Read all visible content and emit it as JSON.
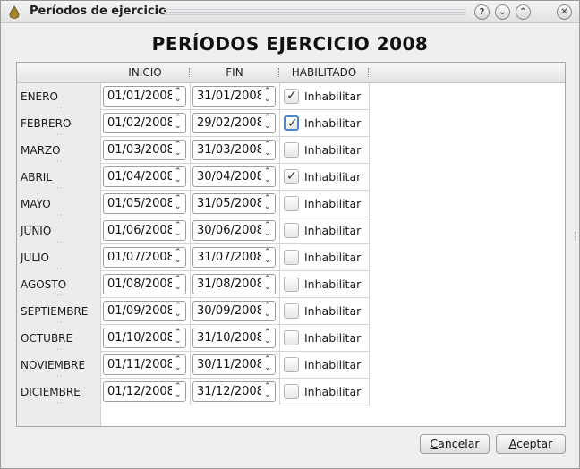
{
  "window": {
    "title": "Períodos de ejercicio",
    "buttons": {
      "help": "?",
      "minimize": "⌄",
      "maximize": "⌃",
      "close": "✕"
    }
  },
  "heading": "PERÍODOS EJERCICIO 2008",
  "table": {
    "columns": [
      "INICIO",
      "FIN",
      "HABILITADO"
    ],
    "checkbox_label": "Inhabilitar",
    "rows": [
      {
        "label": "ENERO",
        "start": "01/01/2008",
        "end": "31/01/2008",
        "checked": true,
        "focused": false
      },
      {
        "label": "FEBRERO",
        "start": "01/02/2008",
        "end": "29/02/2008",
        "checked": true,
        "focused": true
      },
      {
        "label": "MARZO",
        "start": "01/03/2008",
        "end": "31/03/2008",
        "checked": false,
        "focused": false
      },
      {
        "label": "ABRIL",
        "start": "01/04/2008",
        "end": "30/04/2008",
        "checked": true,
        "focused": false
      },
      {
        "label": "MAYO",
        "start": "01/05/2008",
        "end": "31/05/2008",
        "checked": false,
        "focused": false
      },
      {
        "label": "JUNIO",
        "start": "01/06/2008",
        "end": "30/06/2008",
        "checked": false,
        "focused": false
      },
      {
        "label": "JULIO",
        "start": "01/07/2008",
        "end": "31/07/2008",
        "checked": false,
        "focused": false
      },
      {
        "label": "AGOSTO",
        "start": "01/08/2008",
        "end": "31/08/2008",
        "checked": false,
        "focused": false
      },
      {
        "label": "SEPTIEMBRE",
        "start": "01/09/2008",
        "end": "30/09/2008",
        "checked": false,
        "focused": false
      },
      {
        "label": "OCTUBRE",
        "start": "01/10/2008",
        "end": "31/10/2008",
        "checked": false,
        "focused": false
      },
      {
        "label": "NOVIEMBRE",
        "start": "01/11/2008",
        "end": "30/11/2008",
        "checked": false,
        "focused": false
      },
      {
        "label": "DICIEMBRE",
        "start": "01/12/2008",
        "end": "31/12/2008",
        "checked": false,
        "focused": false
      }
    ]
  },
  "footer": {
    "cancel": {
      "mnemonic": "C",
      "rest": "ancelar"
    },
    "accept": {
      "mnemonic": "A",
      "rest": "ceptar"
    }
  }
}
